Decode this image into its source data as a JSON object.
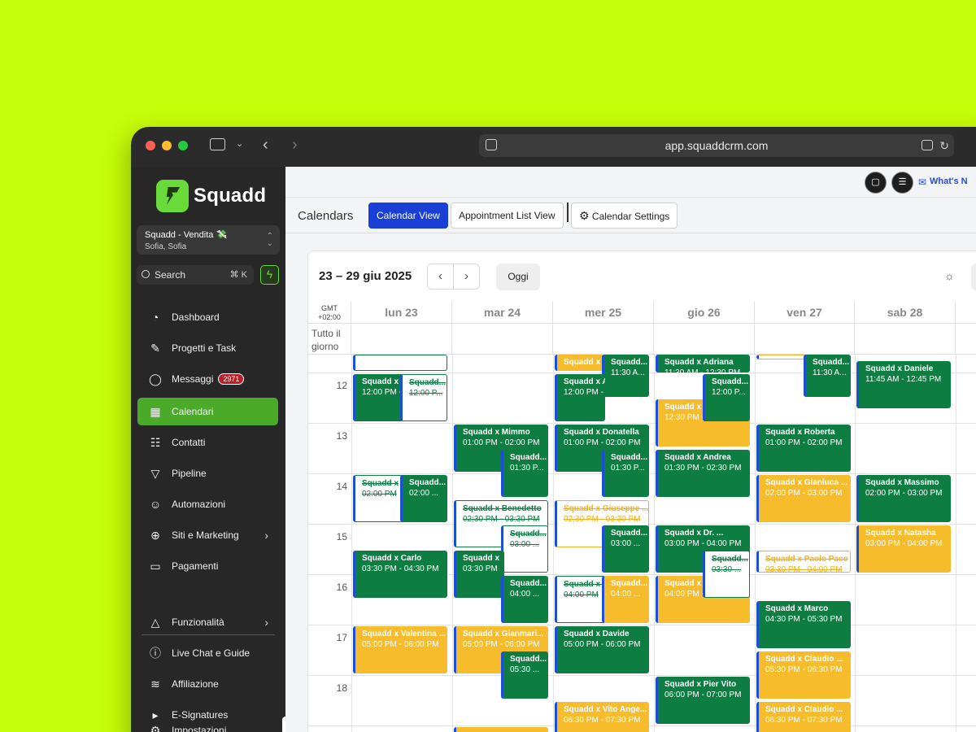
{
  "browser": {
    "url": "app.squaddcrm.com"
  },
  "sidebar": {
    "logo": "Squadd",
    "account": {
      "name": "Squadd - Vendita 💸",
      "user": "Sofia, Sofia"
    },
    "search": {
      "label": "Search",
      "shortcut": "⌘ K"
    },
    "items": [
      {
        "label": "Dashboard",
        "icon": "dashboard-icon"
      },
      {
        "label": "Progetti e Task",
        "icon": "tasks-icon"
      },
      {
        "label": "Messaggi",
        "icon": "chat-icon",
        "badge": "2971"
      },
      {
        "label": "Calendari",
        "icon": "calendar-icon",
        "active": true
      },
      {
        "label": "Contatti",
        "icon": "contacts-icon"
      },
      {
        "label": "Pipeline",
        "icon": "filter-icon"
      },
      {
        "label": "Automazioni",
        "icon": "robot-icon"
      },
      {
        "label": "Siti e Marketing",
        "icon": "globe-icon",
        "arrow": true
      },
      {
        "label": "Pagamenti",
        "icon": "card-icon"
      },
      {
        "label": "Funzionalità",
        "icon": "shapes-icon",
        "arrow": true
      },
      {
        "label": "Live Chat e Guide",
        "icon": "info-icon"
      },
      {
        "label": "Affiliazione",
        "icon": "coins-icon"
      },
      {
        "label": "E-Signatures",
        "icon": "signature-icon"
      },
      {
        "label": "Impostazioni",
        "icon": "settings-icon"
      }
    ]
  },
  "topbar": {
    "whats_new": "What's N"
  },
  "subbar": {
    "title": "Calendars",
    "tabs": [
      "Calendar View",
      "Appointment List View"
    ],
    "settings": "Calendar Settings"
  },
  "calendar": {
    "range": "23 – 29 giu 2025",
    "today_label": "Oggi",
    "gmt": "GMT",
    "gmt_offset": "+02:00",
    "allday_label": "Tutto il giorno",
    "days": [
      "lun 23",
      "mar 24",
      "mer 25",
      "gio 26",
      "ven 27",
      "sab 28"
    ],
    "hours": [
      "12",
      "13",
      "14",
      "15",
      "16",
      "17",
      "18"
    ],
    "accent": "#0d7d42",
    "accent_yellow": "#f6bc2b"
  }
}
